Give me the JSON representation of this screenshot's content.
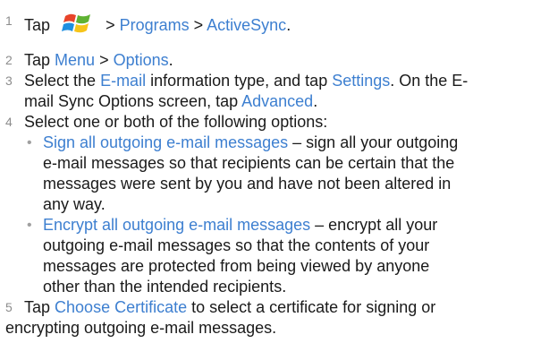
{
  "steps": [
    {
      "num": "1",
      "parts": {
        "tap": "Tap",
        "sep1": " > ",
        "programs": "Programs",
        "sep2": " > ",
        "activesync": "ActiveSync",
        "end": "."
      }
    },
    {
      "num": "2",
      "parts": {
        "tap": "Tap ",
        "menu": "Menu",
        "sep": " > ",
        "options": "Options",
        "end": "."
      }
    },
    {
      "num": "3",
      "parts": {
        "select": "Select the ",
        "email": "E-mail",
        "mid": " information type, and tap ",
        "settings": "Settings",
        "after": ". On the E-",
        "line2": "mail Sync Options screen, tap ",
        "advanced": "Advanced",
        "end": "."
      }
    },
    {
      "num": "4",
      "text": "Select one or both of the following options:"
    },
    {
      "num": "5",
      "parts": {
        "tap": "Tap ",
        "choose": "Choose Certificate",
        "rest1": " to select a certificate for signing or",
        "line2": "encrypting outgoing e-mail messages."
      }
    }
  ],
  "bullets": [
    {
      "dot": "•",
      "title": "Sign all outgoing e-mail messages",
      "dash": " – sign all your outgoing",
      "line2": "e-mail messages so that recipients can be certain that the",
      "line3": "messages were sent by you and have not been altered in",
      "line4": "any way."
    },
    {
      "dot": "•",
      "title": "Encrypt all outgoing e-mail messages",
      "dash": " – encrypt all your",
      "line2": "outgoing e-mail messages so that the contents of your",
      "line3": "messages are protected from being viewed by anyone",
      "line4": "other than the intended recipients."
    }
  ],
  "icons": {
    "start_logo": "windows-start-icon"
  },
  "colors": {
    "link": "#3d7fd0",
    "text": "#1a1a1a",
    "number": "#8c8c8c"
  }
}
